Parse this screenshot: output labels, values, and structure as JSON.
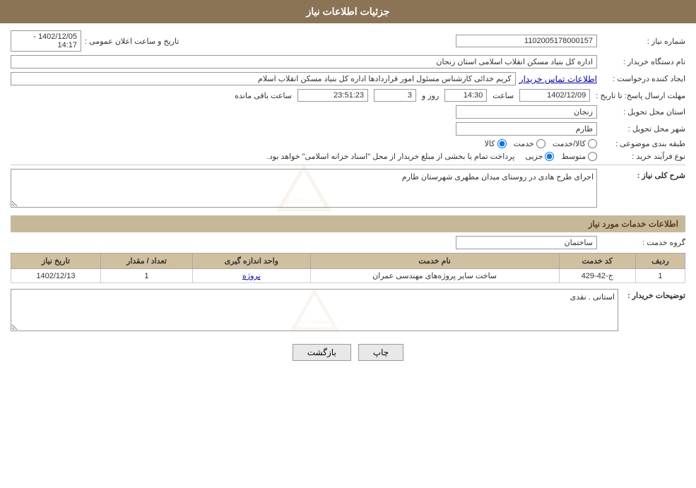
{
  "header": {
    "title": "جزئیات اطلاعات نیاز"
  },
  "fields": {
    "shomareNiaz_label": "شماره نیاز :",
    "shomareNiaz_value": "1102005178000157",
    "namDastgah_label": "نام دستگاه خریدار :",
    "namDastgah_value": "اداره کل بنیاد مسکن انقلاب اسلامی استان زنجان",
    "ijadKonande_label": "ایجاد کننده درخواست :",
    "ijadKonande_value": "کریم خدائی کارشناس مسئول امور قراردادها اداره کل بنیاد مسکن انقلاب اسلام",
    "contact_link": "اطلاعات تماس خریدار",
    "tarikh_label": "تاریخ و ساعت اعلان عمومی :",
    "tarikh_value": "1402/12/05 - 14:17",
    "mohlat_label": "مهلت ارسال پاسخ: تا تاریخ :",
    "mohlat_date": "1402/12/09",
    "mohlat_saat": "14:30",
    "mohlat_roz": "3",
    "mohlat_remaining": "23:51:23",
    "roz_label": "روز و",
    "saat_label": "ساعت",
    "remaining_label": "ساعت باقی مانده",
    "ostan_label": "استان محل تحویل :",
    "ostan_value": "زنجان",
    "shahr_label": "شهر محل تحویل :",
    "shahr_value": "طارم",
    "tabaqe_label": "طبقه بندی موضوعی :",
    "radio_kala": "کالا",
    "radio_khedmat": "خدمت",
    "radio_kala_khedmat": "کالا/خدمت",
    "noeFarayand_label": "نوع فرآیند خرید :",
    "radio_jozi": "جزیی",
    "radio_motevaset": "متوسط",
    "noeFarayand_note": "پرداخت تمام یا بخشی از مبلغ خریدار از محل \"اسناد خزانه اسلامی\" خواهد بود.",
    "sharh_label": "شرح کلی نیاز :",
    "sharh_value": "اجرای طرح هادی در روستای میدان مطهری شهرستان  طارم",
    "services_section_title": "اطلاعات خدمات مورد نیاز",
    "gerohe_label": "گروه خدمت :",
    "gerohe_value": "ساختمان",
    "table": {
      "cols": [
        "ردیف",
        "کد خدمت",
        "نام خدمت",
        "واحد اندازه گیری",
        "تعداد / مقدار",
        "تاریخ نیاز"
      ],
      "rows": [
        {
          "radif": "1",
          "kod": "ج-42-429",
          "name": "ساخت سایر پروژه‌های مهندسی عمران",
          "vahed": "پروژه",
          "tedad": "1",
          "tarikh": "1402/12/13"
        }
      ]
    },
    "buyer_desc_label": "توضیحات خریدار :",
    "buyer_desc_value": "استانی . نقدی",
    "btn_print": "چاپ",
    "btn_back": "بازگشت"
  }
}
